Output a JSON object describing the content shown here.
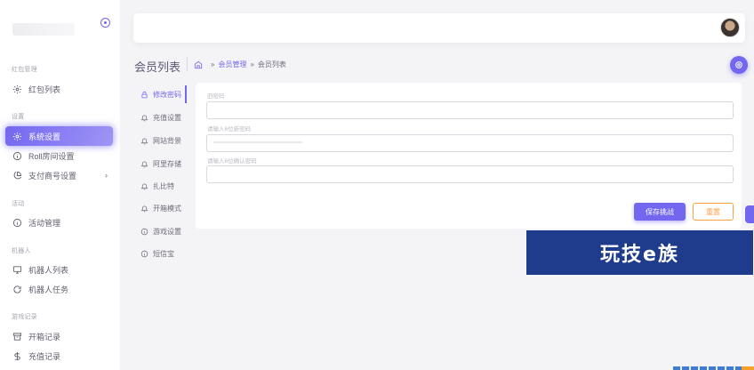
{
  "sidebar": {
    "brand": "",
    "sections": [
      {
        "title": "红包管理",
        "items": [
          {
            "label": "红包列表",
            "icon": "gear-icon"
          }
        ]
      },
      {
        "title": "设置",
        "items": [
          {
            "label": "系统设置",
            "icon": "gear-icon",
            "active": true
          },
          {
            "label": "Roll房间设置",
            "icon": "info-circle-icon"
          },
          {
            "label": "支付商号设置",
            "icon": "pie-chart-icon",
            "has_children": true
          }
        ]
      },
      {
        "title": "活动",
        "items": [
          {
            "label": "活动管理",
            "icon": "info-circle-icon"
          }
        ]
      },
      {
        "title": "机器人",
        "items": [
          {
            "label": "机器人列表",
            "icon": "monitor-icon"
          },
          {
            "label": "机器人任务",
            "icon": "refresh-icon"
          }
        ]
      },
      {
        "title": "游戏记录",
        "items": [
          {
            "label": "开箱记录",
            "icon": "archive-icon"
          },
          {
            "label": "充值记录",
            "icon": "dollar-icon"
          }
        ]
      }
    ]
  },
  "page": {
    "title": "会员列表",
    "breadcrumb": [
      "会员管理",
      "会员列表"
    ]
  },
  "tabs": [
    {
      "label": "修改密码",
      "icon": "lock-icon",
      "active": true
    },
    {
      "label": "充值设置",
      "icon": "bell-icon"
    },
    {
      "label": "网站背景",
      "icon": "bell-icon"
    },
    {
      "label": "阿里存储",
      "icon": "bell-icon"
    },
    {
      "label": "扎比特",
      "icon": "bell-icon"
    },
    {
      "label": "开箱模式",
      "icon": "bell-icon"
    },
    {
      "label": "游戏设置",
      "icon": "info-circle-icon"
    },
    {
      "label": "短信宝",
      "icon": "info-circle-icon"
    }
  ],
  "form": {
    "fields": [
      {
        "label": "旧密码",
        "value": ""
      },
      {
        "label": "请输入6位新密码",
        "value": ""
      },
      {
        "label": "请输入6位确认密码",
        "value": ""
      }
    ],
    "save_label": "保存挑战",
    "reset_label": "重置"
  },
  "watermark": {
    "text": "玩技e族"
  },
  "colors": {
    "accent": "#7367f0",
    "warning": "#ff9f43",
    "banner": "#1f3b8c"
  }
}
